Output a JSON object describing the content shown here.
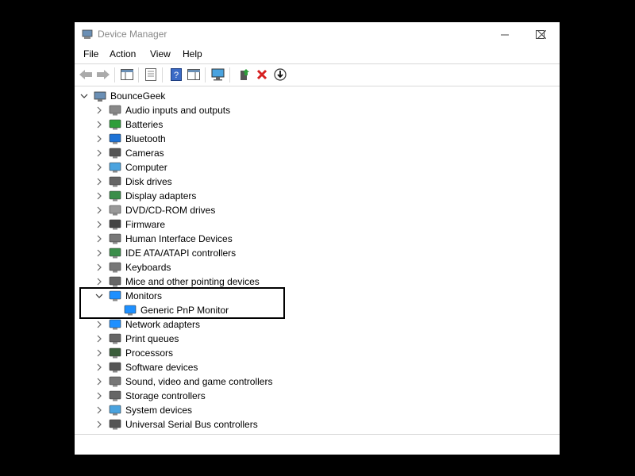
{
  "window": {
    "title": "Device Manager"
  },
  "menu": [
    "File",
    "Action",
    "View",
    "Help"
  ],
  "toolbar": {
    "buttons": [
      "back-arrow-icon",
      "forward-arrow-icon",
      "show-hide-console-tree-icon",
      "properties-icon",
      "help-icon",
      "action-pane-icon",
      "scan-hardware-icon",
      "update-driver-icon",
      "uninstall-device-icon",
      "disable-device-icon"
    ]
  },
  "tree": {
    "root": "BounceGeek",
    "categories": [
      {
        "label": "Audio inputs and outputs",
        "icon": "speaker-icon"
      },
      {
        "label": "Batteries",
        "icon": "battery-icon"
      },
      {
        "label": "Bluetooth",
        "icon": "bluetooth-icon"
      },
      {
        "label": "Cameras",
        "icon": "camera-icon"
      },
      {
        "label": "Computer",
        "icon": "computer-icon"
      },
      {
        "label": "Disk drives",
        "icon": "disk-drive-icon"
      },
      {
        "label": "Display adapters",
        "icon": "display-adapter-icon"
      },
      {
        "label": "DVD/CD-ROM drives",
        "icon": "dvd-drive-icon"
      },
      {
        "label": "Firmware",
        "icon": "firmware-icon"
      },
      {
        "label": "Human Interface Devices",
        "icon": "hid-icon"
      },
      {
        "label": "IDE ATA/ATAPI controllers",
        "icon": "ide-controller-icon"
      },
      {
        "label": "Keyboards",
        "icon": "keyboard-icon"
      },
      {
        "label": "Mice and other pointing devices",
        "icon": "mouse-icon"
      },
      {
        "label": "Monitors",
        "icon": "monitor-icon",
        "expanded": true,
        "children": [
          "Generic PnP Monitor"
        ]
      },
      {
        "label": "Network adapters",
        "icon": "network-adapter-icon"
      },
      {
        "label": "Print queues",
        "icon": "printer-icon"
      },
      {
        "label": "Processors",
        "icon": "processor-icon"
      },
      {
        "label": "Software devices",
        "icon": "software-device-icon"
      },
      {
        "label": "Sound, video and game controllers",
        "icon": "sound-icon"
      },
      {
        "label": "Storage controllers",
        "icon": "storage-controller-icon"
      },
      {
        "label": "System devices",
        "icon": "system-device-icon"
      },
      {
        "label": "Universal Serial Bus controllers",
        "icon": "usb-icon"
      }
    ]
  },
  "colors": {
    "accent_box": "#000000",
    "monitor_blue": "#1e90ff"
  }
}
